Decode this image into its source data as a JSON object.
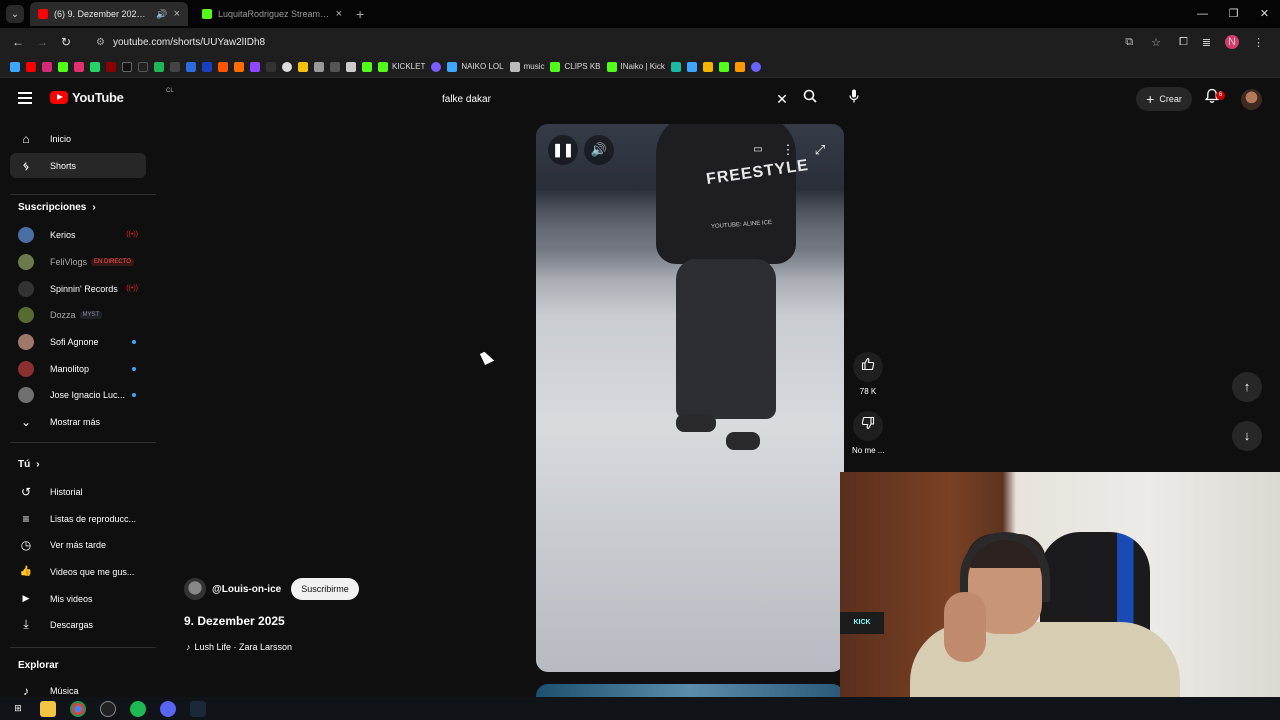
{
  "browser": {
    "tabs": [
      {
        "title": "(6) 9. Dezember 2025 - You",
        "active": true,
        "favicon_color": "#ff0000"
      },
      {
        "title": "LuquitaRodriguez Stream - Wa",
        "active": false,
        "favicon_color": "#53fc18"
      }
    ],
    "url": "youtube.com/shorts/UUYaw2lIDh8",
    "profile_initial": "N",
    "window_controls": [
      "—",
      "❐",
      "✕"
    ],
    "bookmarks": [
      {
        "label": "KICKLET",
        "color": "#53fc18"
      },
      {
        "label": "NAIKO LOL",
        "color": "#3ea6ff"
      },
      {
        "label": "music",
        "color": "#bbbbbb"
      },
      {
        "label": "CLIPS KB",
        "color": "#53fc18"
      },
      {
        "label": "INaiko | Kick",
        "color": "#53fc18"
      }
    ]
  },
  "header": {
    "logo_text": "YouTube",
    "country_code": "CL",
    "search_value": "falke dakar",
    "create_label": "Crear",
    "notifications_count": "6"
  },
  "sidebar": {
    "main": [
      {
        "label": "Inicio",
        "icon": "home-icon",
        "glyph": "⌂"
      },
      {
        "label": "Shorts",
        "icon": "shorts-icon",
        "glyph": "ᛃ"
      }
    ],
    "subscriptions_title": "Suscripciones",
    "subscriptions": [
      {
        "label": "Kerios",
        "color": "#4a6fa5",
        "status": "live"
      },
      {
        "label": "FeliVlogs",
        "color": "#6a7a4a",
        "status": "en-directo"
      },
      {
        "label": "Spinnin' Records",
        "color": "#333333",
        "status": "live"
      },
      {
        "label": "Dozza",
        "color": "#556b2f",
        "status": "myst"
      },
      {
        "label": "Sofi Agnone",
        "color": "#a0786a",
        "status": "new"
      },
      {
        "label": "Manolitop",
        "color": "#8a3030",
        "status": "new"
      },
      {
        "label": "Jose Ignacio Luc...",
        "color": "#707070",
        "status": "new"
      }
    ],
    "live_badge": "EN DIRECTO",
    "myst_badge": "MYST",
    "show_more": "Mostrar más",
    "you_title": "Tú",
    "you_items": [
      {
        "label": "Historial",
        "glyph": "↺"
      },
      {
        "label": "Listas de reproducc...",
        "glyph": "≡"
      },
      {
        "label": "Ver más tarde",
        "glyph": "◷"
      },
      {
        "label": "Videos que me gus...",
        "glyph": "👍"
      },
      {
        "label": "Mis videos",
        "glyph": "▶"
      },
      {
        "label": "Descargas",
        "glyph": "⤓"
      }
    ],
    "explore_title": "Explorar",
    "explore_items": [
      {
        "label": "Música",
        "glyph": "♪"
      }
    ]
  },
  "short": {
    "channel": "@Louis-on-ice",
    "subscribe_label": "Suscribirme",
    "title": "9. Dezember 2025",
    "music": "Lush Life · Zara Larsson",
    "likes": "78 K",
    "dislike_label": "No me ...",
    "hoodie_text": "FREESTYLE",
    "hoodie_small": "YOUTUBE: ALINE ICE"
  },
  "webcam": {
    "sign_text": "KICK"
  }
}
